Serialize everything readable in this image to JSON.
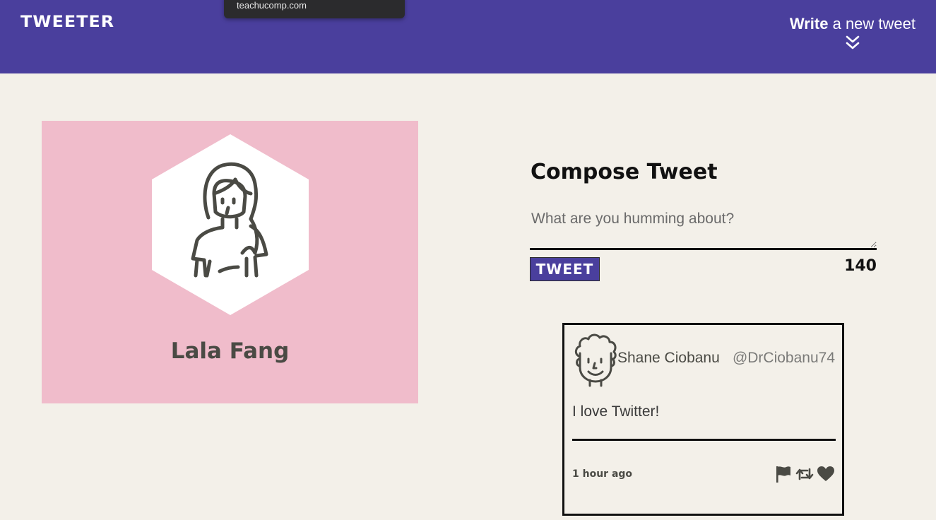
{
  "nav": {
    "brand": "TWEETER",
    "write_bold": "Write",
    "write_rest": " a new tweet",
    "write_icon": "double-chevron-down-icon"
  },
  "tooltip": {
    "text": "teachucomp.com"
  },
  "profile": {
    "name": "Lala Fang",
    "avatar_icon": "woman-avatar-icon",
    "background_color": "#f0bccb"
  },
  "compose": {
    "title": "Compose Tweet",
    "placeholder": "What are you humming about?",
    "button_label": "TWEET",
    "counter": "140"
  },
  "tweets": [
    {
      "name": "Shane Ciobanu",
      "handle": "@DrCiobanu74",
      "text": "I love Twitter!",
      "time": "1 hour ago",
      "avatar_icon": "curly-hair-avatar-icon",
      "actions": [
        "flag-icon",
        "retweet-icon",
        "heart-icon"
      ]
    }
  ],
  "colors": {
    "accent": "#4a3f9d",
    "background": "#f3f0e9",
    "text_dark": "#111111"
  }
}
